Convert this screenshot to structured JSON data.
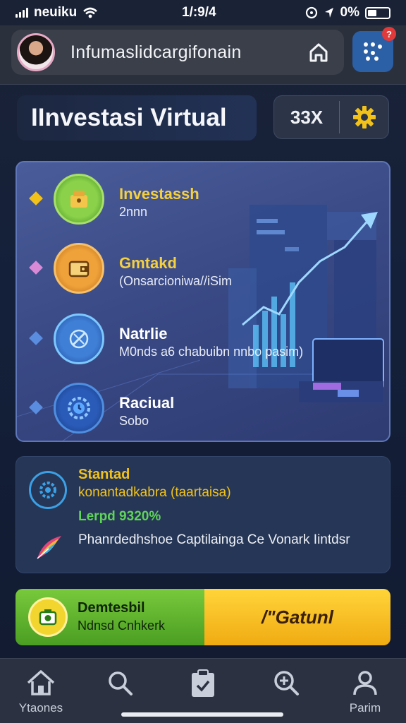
{
  "status_bar": {
    "carrier": "neuiku",
    "time": "1/:9/4",
    "battery": "0%"
  },
  "header": {
    "title": "Infumaslidcargifonain",
    "notification_count": "?"
  },
  "page": {
    "title": "IInvestasi Virtual",
    "multiplier": "33X"
  },
  "investments": [
    {
      "title": "Investassh",
      "subtitle": "2nnn",
      "title_color": "#f4d03f",
      "icon": "treasure-icon",
      "diamond_color": "#f2c21b"
    },
    {
      "title": "Gmtakd",
      "subtitle": "(Onsarcioniwa//iSim",
      "title_color": "#f4d03f",
      "icon": "wallet-icon",
      "diamond_color": "#d98ad6"
    },
    {
      "title": "Natrlie",
      "subtitle": "M0nds a6 chabuibn nnbo pasim)",
      "title_color": "#ffffff",
      "icon": "tools-icon",
      "diamond_color": "#5a8de0"
    },
    {
      "title": "Raciual",
      "subtitle": "Sobo",
      "title_color": "#ffffff",
      "icon": "gear-clock-icon",
      "diamond_color": "#5a8de0"
    }
  ],
  "strategy": {
    "title": "Stantad",
    "subtitle": "konantadkabra (taartaisa)",
    "highlight": "Lerpd 9320%",
    "description": "Phanrdedhshoe Captilainga Ce Vonark Iintdsr"
  },
  "buttons": {
    "green_title": "Demtesbil",
    "green_subtitle": "Ndnsd Cnhkerk",
    "yellow_label": "/\"Gatunl"
  },
  "bottom_nav": [
    {
      "label": "Ytaones",
      "icon": "home-icon"
    },
    {
      "label": "",
      "icon": "search-icon"
    },
    {
      "label": "",
      "icon": "clipboard-icon"
    },
    {
      "label": "",
      "icon": "zoom-in-icon"
    },
    {
      "label": "Parim",
      "icon": "profile-icon"
    }
  ],
  "colors": {
    "accent_yellow": "#f2c21b",
    "accent_green": "#5fd35a",
    "accent_blue": "#2b5fa6"
  }
}
